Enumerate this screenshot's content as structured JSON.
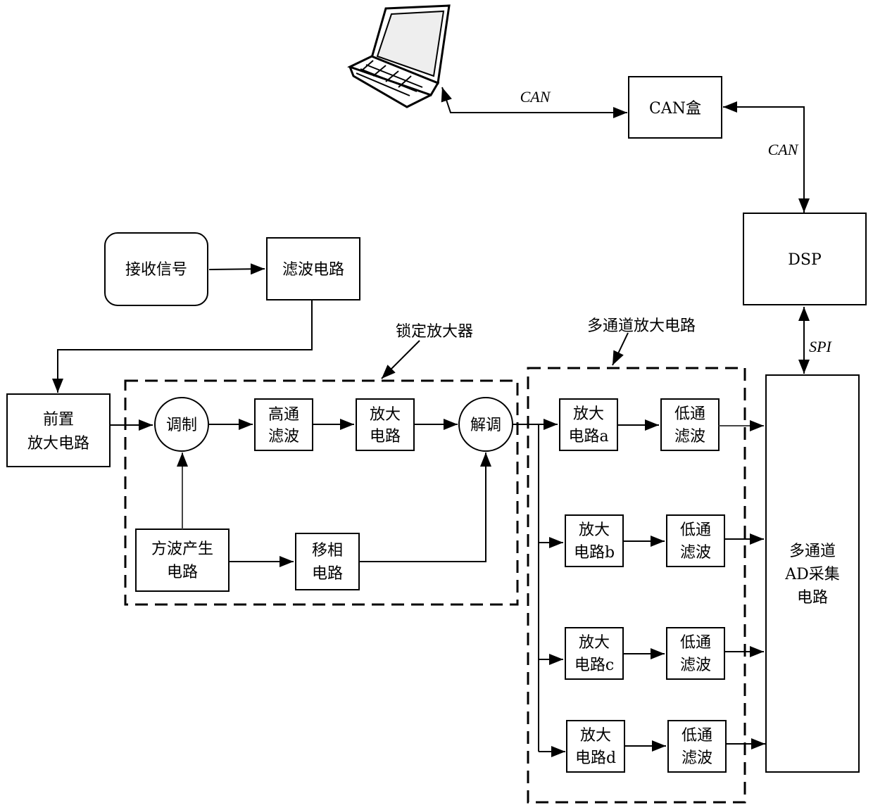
{
  "diagram": {
    "nodes": {
      "laptop": {
        "icon": "laptop-icon"
      },
      "can_box": {
        "label": "CAN盒"
      },
      "dsp": {
        "label": "DSP"
      },
      "receive_signal": {
        "label": "接收信号"
      },
      "filter_circuit": {
        "label": "滤波电路"
      },
      "preamp": {
        "line1": "前置",
        "line2": "放大电路"
      },
      "modulate": {
        "label": "调制"
      },
      "highpass": {
        "line1": "高通",
        "line2": "滤波"
      },
      "amp": {
        "line1": "放大",
        "line2": "电路"
      },
      "demodulate": {
        "label": "解调"
      },
      "square_wave": {
        "line1": "方波产生",
        "line2": "电路"
      },
      "phase_shift": {
        "line1": "移相",
        "line2": "电路"
      },
      "amp_a": {
        "line1": "放大",
        "line2": "电路a"
      },
      "amp_b": {
        "line1": "放大",
        "line2": "电路b"
      },
      "amp_c": {
        "line1": "放大",
        "line2": "电路c"
      },
      "amp_d": {
        "line1": "放大",
        "line2": "电路d"
      },
      "lowpass_a": {
        "line1": "低通",
        "line2": "滤波"
      },
      "lowpass_b": {
        "line1": "低通",
        "line2": "滤波"
      },
      "lowpass_c": {
        "line1": "低通",
        "line2": "滤波"
      },
      "lowpass_d": {
        "line1": "低通",
        "line2": "滤波"
      },
      "ad": {
        "line1": "多通道",
        "line2": "AD采集",
        "line3": "电路"
      }
    },
    "groups": {
      "lockin": {
        "label": "锁定放大器"
      },
      "multichannel": {
        "label": "多通道放大电路"
      }
    },
    "edges": {
      "laptop_can": {
        "label": "CAN"
      },
      "canbox_dsp": {
        "label": "CAN"
      },
      "dsp_ad": {
        "label": "SPI"
      }
    }
  }
}
